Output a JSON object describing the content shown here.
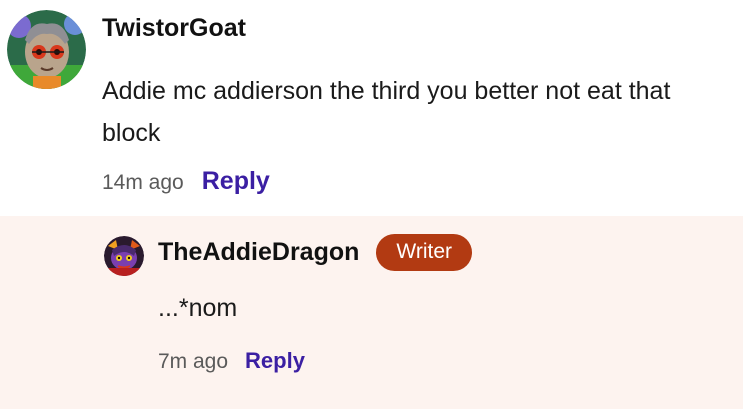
{
  "comment": {
    "username": "TwistorGoat",
    "avatar_icon": "user-avatar-goat",
    "body": "Addie mc addierson the third you better not eat that block",
    "time": "14m ago",
    "reply_label": "Reply"
  },
  "reply": {
    "username": "TheAddieDragon",
    "avatar_icon": "user-avatar-dragon",
    "badge": "Writer",
    "body": "...*nom",
    "time": "7m ago",
    "reply_label": "Reply"
  },
  "colors": {
    "accent": "#3b1fa3",
    "badge": "#b23a12",
    "reply_background": "#fdf3ef"
  }
}
